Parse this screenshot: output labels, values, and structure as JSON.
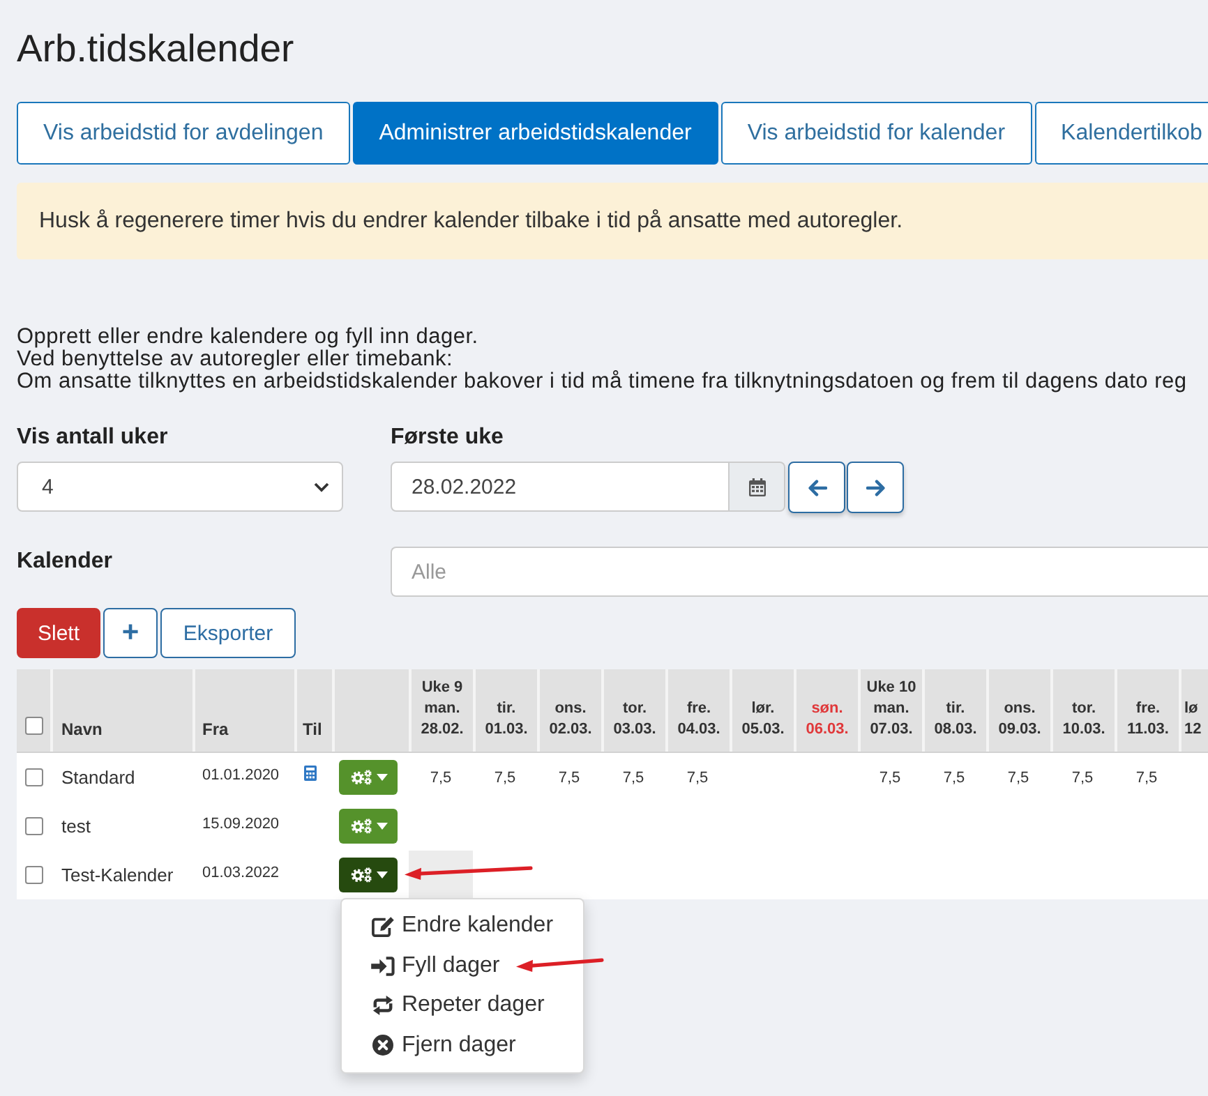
{
  "page": {
    "title": "Arb.tidskalender"
  },
  "tabs": [
    {
      "label": "Vis arbeidstid for avdelingen",
      "selected": false
    },
    {
      "label": "Administrer arbeidstidskalender",
      "selected": true
    },
    {
      "label": "Vis arbeidstid for kalender",
      "selected": false
    },
    {
      "label": "Kalendertilkob",
      "selected": false
    }
  ],
  "alert": {
    "text": "Husk å regenerere timer hvis du endrer kalender tilbake i tid på ansatte med autoregler."
  },
  "intro": [
    "Opprett eller endre kalendere og fyll inn dager.",
    "Ved benyttelse av autoregler eller timebank:",
    "Om ansatte tilknyttes en arbeidstidskalender bakover i tid må timene fra tilknytningsdatoen og frem til dagens dato reg"
  ],
  "filters": {
    "weeks": {
      "label": "Vis antall uker",
      "value": "4"
    },
    "first_week": {
      "label": "Første uke",
      "value": "28.02.2022"
    },
    "calendar": {
      "label": "Kalender",
      "placeholder": "Alle"
    }
  },
  "toolbar": [
    {
      "kind": "danger",
      "label": "Slett"
    },
    {
      "kind": "add",
      "label": "+"
    },
    {
      "kind": "outline",
      "label": "Eksporter"
    }
  ],
  "table": {
    "select_all": {
      "checked": false
    },
    "columns": [
      "Navn",
      "Fra",
      "Til"
    ],
    "days": [
      {
        "week": "Uke 9",
        "day": "man.",
        "date": "28.02.",
        "holiday": false
      },
      {
        "day": "tir.",
        "date": "01.03.",
        "holiday": false
      },
      {
        "day": "ons.",
        "date": "02.03.",
        "holiday": false
      },
      {
        "day": "tor.",
        "date": "03.03.",
        "holiday": false
      },
      {
        "day": "fre.",
        "date": "04.03.",
        "holiday": false
      },
      {
        "day": "lør.",
        "date": "05.03.",
        "holiday": false
      },
      {
        "day": "søn.",
        "date": "06.03.",
        "holiday": true
      },
      {
        "week": "Uke 10",
        "day": "man.",
        "date": "07.03.",
        "holiday": false
      },
      {
        "day": "tir.",
        "date": "08.03.",
        "holiday": false
      },
      {
        "day": "ons.",
        "date": "09.03.",
        "holiday": false
      },
      {
        "day": "tor.",
        "date": "10.03.",
        "holiday": false
      },
      {
        "day": "fre.",
        "date": "11.03.",
        "holiday": false
      },
      {
        "day": "lø",
        "date": "12",
        "holiday": false
      }
    ],
    "rows": [
      {
        "checked": false,
        "name": "Standard",
        "from": "01.01.2020",
        "til_icon": true,
        "menu_open": false,
        "marked": false,
        "days": [
          {
            "hours": "7,5",
            "highlighted": false
          },
          {
            "hours": "7,5",
            "highlighted": false
          },
          {
            "hours": "7,5",
            "highlighted": false
          },
          {
            "hours": "7,5",
            "highlighted": false
          },
          {
            "hours": "7,5",
            "highlighted": false
          },
          {
            "highlighted": false
          },
          {
            "highlighted": false
          },
          {
            "hours": "7,5",
            "highlighted": false
          },
          {
            "hours": "7,5",
            "highlighted": false
          },
          {
            "hours": "7,5",
            "highlighted": false
          },
          {
            "hours": "7,5",
            "highlighted": false
          },
          {
            "hours": "7,5",
            "highlighted": false
          },
          {
            "highlighted": false
          }
        ]
      },
      {
        "checked": false,
        "name": "test",
        "from": "15.09.2020",
        "til_icon": false,
        "menu_open": false,
        "marked": false,
        "days": [
          {
            "highlighted": false
          },
          {
            "highlighted": false
          },
          {
            "highlighted": false
          },
          {
            "highlighted": false
          },
          {
            "highlighted": false
          },
          {
            "highlighted": false
          },
          {
            "highlighted": false
          },
          {
            "highlighted": false
          },
          {
            "highlighted": false
          },
          {
            "highlighted": false
          },
          {
            "highlighted": false
          },
          {
            "highlighted": false
          },
          {
            "highlighted": false
          }
        ]
      },
      {
        "checked": false,
        "name": "Test-Kalender",
        "from": "01.03.2022",
        "til_icon": false,
        "menu_open": true,
        "marked": true,
        "days": [
          {
            "highlighted": true
          },
          {
            "highlighted": false
          },
          {
            "highlighted": false
          },
          {
            "highlighted": false
          },
          {
            "highlighted": false
          },
          {
            "highlighted": false
          },
          {
            "highlighted": false
          },
          {
            "highlighted": false
          },
          {
            "highlighted": false
          },
          {
            "highlighted": false
          },
          {
            "highlighted": false
          },
          {
            "highlighted": false
          },
          {
            "highlighted": false
          }
        ]
      }
    ]
  },
  "menu": {
    "items": [
      {
        "kind": "edit",
        "label": "Endre kalender",
        "marked": false
      },
      {
        "kind": "fill",
        "label": "Fyll dager",
        "marked": true
      },
      {
        "kind": "repeat",
        "label": "Repeter dager",
        "marked": false
      },
      {
        "kind": "remove",
        "label": "Fjern dager",
        "marked": false
      }
    ]
  }
}
